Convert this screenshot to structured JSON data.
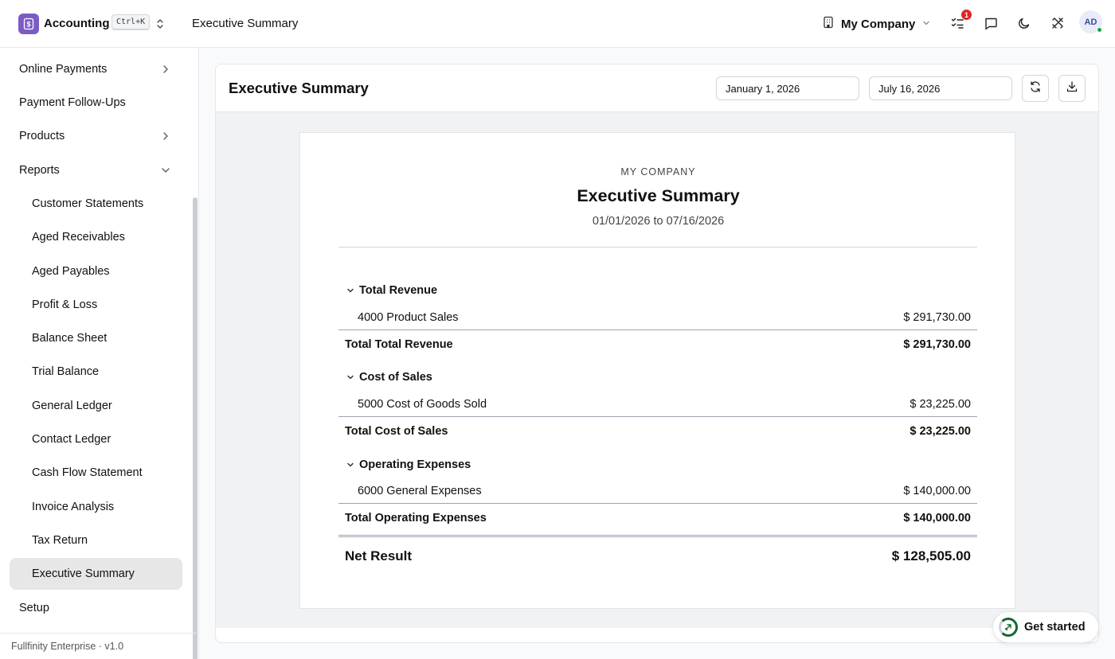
{
  "header": {
    "app_name": "Accounting",
    "shortcut": "Ctrl+K",
    "breadcrumb": "Executive Summary",
    "company": "My Company",
    "notification_count": "1",
    "avatar_initials": "AD",
    "icons": [
      "building-icon",
      "chevron-down-icon",
      "tasks-icon",
      "chat-icon",
      "moon-icon",
      "tools-icon"
    ]
  },
  "sidebar": {
    "items": [
      {
        "label": "Online Payments",
        "chevron": "right"
      },
      {
        "label": "Payment Follow-Ups"
      },
      {
        "label": "Products",
        "chevron": "right"
      },
      {
        "label": "Reports",
        "chevron": "down"
      },
      {
        "label": "Customer Statements"
      },
      {
        "label": "Aged Receivables"
      },
      {
        "label": "Aged Payables"
      },
      {
        "label": "Profit & Loss"
      },
      {
        "label": "Balance Sheet"
      },
      {
        "label": "Trial Balance"
      },
      {
        "label": "General Ledger"
      },
      {
        "label": "Contact Ledger"
      },
      {
        "label": "Cash Flow Statement"
      },
      {
        "label": "Invoice Analysis"
      },
      {
        "label": "Tax Return"
      },
      {
        "label": "Executive Summary",
        "active": true
      },
      {
        "label": "Setup"
      }
    ],
    "footer": "Fullfinity Enterprise · v1.0"
  },
  "toolbar": {
    "title": "Executive Summary",
    "start_date": "January 1, 2026",
    "end_date": "July 16, 2026"
  },
  "report": {
    "company": "MY COMPANY",
    "title": "Executive Summary",
    "period": "01/01/2026 to 07/16/2026",
    "sections": [
      {
        "heading": "Total Revenue",
        "account": "4000 Product Sales",
        "account_value": "$ 291,730.00",
        "total_label": "Total Total Revenue",
        "total_value": "$ 291,730.00"
      },
      {
        "heading": "Cost of Sales",
        "account": "5000 Cost of Goods Sold",
        "account_value": "$ 23,225.00",
        "total_label": "Total Cost of Sales",
        "total_value": "$ 23,225.00"
      },
      {
        "heading": "Operating Expenses",
        "account": "6000 General Expenses",
        "account_value": "$ 140,000.00",
        "total_label": "Total Operating Expenses",
        "total_value": "$ 140,000.00"
      }
    ],
    "net_label": "Net Result",
    "net_value": "$ 128,505.00"
  },
  "get_started": "Get started",
  "colors": {
    "brand": "#7c5cc4",
    "badge": "#dc2626",
    "progress": "#166534",
    "active_bg": "#e7e7e7"
  }
}
